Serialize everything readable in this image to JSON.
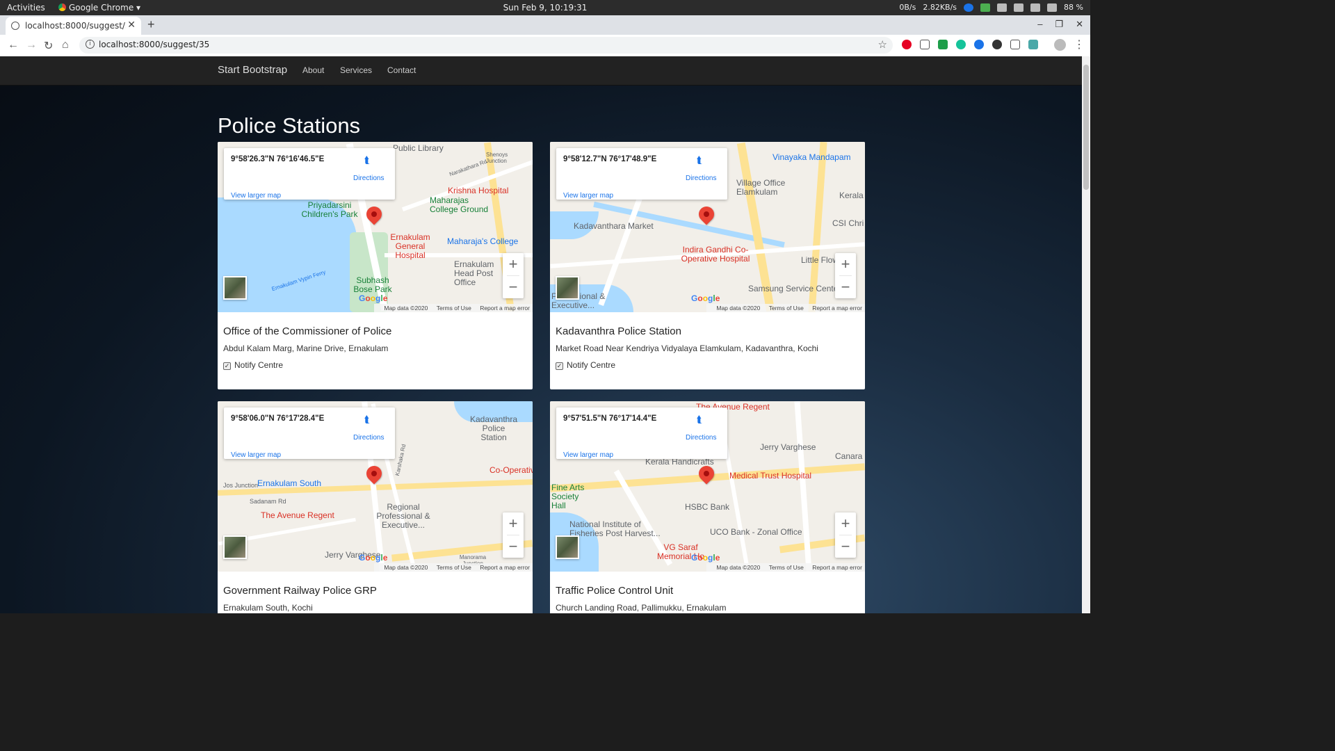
{
  "os_topbar": {
    "activities": "Activities",
    "app_name": "Google Chrome ▾",
    "clock": "Sun Feb  9, 10:19:31",
    "net_down": "0B/s",
    "net_up": "2.82KB/s",
    "battery": "88 %"
  },
  "browser": {
    "tab_title": "localhost:8000/suggest/35",
    "url": "localhost:8000/suggest/35"
  },
  "navbar": {
    "brand": "Start Bootstrap",
    "links": [
      "About",
      "Services",
      "Contact"
    ]
  },
  "page": {
    "title": "Police Stations",
    "notify_label": "Notify Centre",
    "map_ui": {
      "directions": "Directions",
      "view_larger": "View larger map",
      "map_data": "Map data ©2020",
      "terms": "Terms of Use",
      "report": "Report a map error",
      "google": "Google"
    },
    "stations": [
      {
        "coords": "9°58'26.3\"N 76°16'46.5\"E",
        "name": "Office of the Commissioner of Police",
        "address": "Abdul Kalam Marg, Marine Drive, Ernakulam",
        "notify": true,
        "map_labels": {
          "a": "Public Library",
          "b": "Krishna Hospital",
          "c": "Maharajas College Ground",
          "d": "Priyadarsini Children's Park",
          "e": "Ernakulam General Hospital",
          "f": "Maharaja's College",
          "g": "Ernakulam Head Post Office",
          "h": "Subhash Bose Park",
          "i": "Shenoys Junction",
          "j": "Narakathara Rd",
          "k": "Ernakulam Vypin Ferry"
        }
      },
      {
        "coords": "9°58'12.7\"N 76°17'48.9\"E",
        "name": "Kadavanthra Police Station",
        "address": "Market Road Near Kendriya Vidyalaya Elamkulam, Kadavanthra, Kochi",
        "notify": true,
        "map_labels": {
          "a": "Vinayaka Mandapam",
          "b": "Village Office Elamkulam",
          "c": "Kerala",
          "d": "Kadavanthara Market",
          "e": "CSI Chri",
          "f": "Indira Gandhi Co-Operative Hospital",
          "g": "Little Flow",
          "h": "Samsung Service Center",
          "i": "Professional & Executive..."
        }
      },
      {
        "coords": "9°58'06.0\"N 76°17'28.4\"E",
        "name": "Government Railway Police GRP",
        "address": "Ernakulam South, Kochi",
        "notify": true,
        "map_labels": {
          "a": "Kadavanthra Police Station",
          "b": "Ernakulam South",
          "c": "Jos Junction",
          "d": "Sadanam Rd",
          "e": "The Avenue Regent",
          "f": "Regional Professional & Executive...",
          "g": "Jerry Varghese",
          "h": "Manorama Junction",
          "i": "Co-Operativ",
          "j": "Karshaka Rd"
        }
      },
      {
        "coords": "9°57'51.5\"N 76°17'14.4\"E",
        "name": "Traffic Police Control Unit",
        "address": "Church Landing Road, Pallimukku, Ernakulam",
        "notify": true,
        "map_labels": {
          "a": "The Avenue Regent",
          "b": "Jerry Varghese",
          "c": "Canara",
          "d": "Kerala Handicrafts",
          "e": "Medical Trust Hospital",
          "f": "Fine Arts Society Hall",
          "g": "HSBC Bank",
          "h": "National Institute of Fisheries Post Harvest...",
          "i": "UCO Bank - Zonal Office",
          "j": "VG Saraf Memorial Ho"
        }
      }
    ]
  }
}
